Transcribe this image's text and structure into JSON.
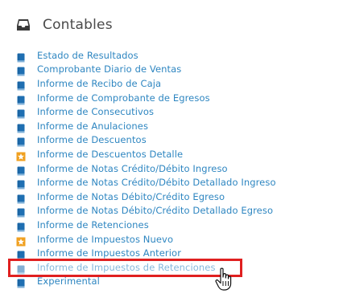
{
  "section": {
    "icon": "inbox-tray-icon",
    "title": "Contables"
  },
  "colors": {
    "link": "#2e86c1",
    "link_active": "#85b8dc",
    "highlight_border": "#e02020",
    "star_icon": "#f0a020"
  },
  "items": [
    {
      "label": "Estado de Resultados",
      "icon": "book-icon"
    },
    {
      "label": "Comprobante Diario de Ventas",
      "icon": "book-icon"
    },
    {
      "label": "Informe de Recibo de Caja",
      "icon": "book-icon"
    },
    {
      "label": "Informe de Comprobante de Egresos",
      "icon": "book-icon"
    },
    {
      "label": "Informe de Consecutivos",
      "icon": "book-icon"
    },
    {
      "label": "Informe de Anulaciones",
      "icon": "book-icon"
    },
    {
      "label": "Informe de Descuentos",
      "icon": "book-icon"
    },
    {
      "label": "Informe de Descuentos Detalle",
      "icon": "star-icon"
    },
    {
      "label": "Informe de Notas Crédito/Débito Ingreso",
      "icon": "book-icon"
    },
    {
      "label": "Informe de Notas Crédito/Débito Detallado Ingreso",
      "icon": "book-icon"
    },
    {
      "label": "Informe de Notas Débito/Crédito Egreso",
      "icon": "book-icon"
    },
    {
      "label": "Informe de Notas Débito/Crédito Detallado Egreso",
      "icon": "book-icon"
    },
    {
      "label": "Informe de Retenciones",
      "icon": "book-icon"
    },
    {
      "label": "Informe de Impuestos Nuevo",
      "icon": "star-icon"
    },
    {
      "label": "Informe de Impuestos Anterior",
      "icon": "book-icon"
    },
    {
      "label": "Informe de Impuestos de Retenciones",
      "icon": "book-icon",
      "active": true
    },
    {
      "label": "Experimental",
      "icon": "book-icon"
    }
  ],
  "cursor": "hand-pointer-icon"
}
